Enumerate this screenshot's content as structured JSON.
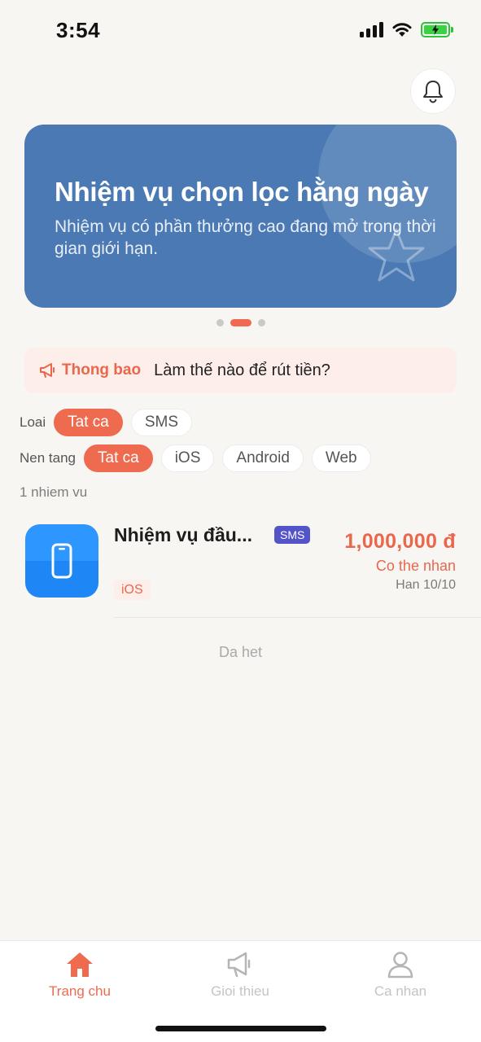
{
  "status_bar": {
    "time": "3:54",
    "icons": [
      "signal-icon",
      "wifi-icon",
      "battery-charging-icon"
    ]
  },
  "header": {
    "bell_icon": "bell-icon"
  },
  "banner": {
    "title": "Nhiệm vụ chọn lọc hằng ngày",
    "subtitle": "Nhiệm vụ có phần thưởng cao đang mở trong thời gian giới hạn.",
    "background_color": "#4a79b4",
    "decoration_icon": "star-icon",
    "pagination": {
      "total": 3,
      "active_index": 1
    }
  },
  "notice": {
    "icon": "megaphone-icon",
    "label": "Thong bao",
    "text": "Làm thế nào để rút tiền?"
  },
  "filters": {
    "type": {
      "label": "Loai",
      "options": [
        "Tat ca",
        "SMS"
      ],
      "selected": "Tat ca"
    },
    "platform": {
      "label": "Nen tang",
      "options": [
        "Tat ca",
        "iOS",
        "Android",
        "Web"
      ],
      "selected": "Tat ca"
    }
  },
  "task_count": "1 nhiem vu",
  "tasks": [
    {
      "icon": "phone-icon",
      "title": "Nhiệm vụ đầu...",
      "badge": "SMS",
      "platform": "iOS",
      "reward": "1,000,000 đ",
      "status": "Co the nhan",
      "deadline": "Han 10/10"
    }
  ],
  "end_text": "Da het",
  "tab_bar": {
    "items": [
      {
        "label": "Trang chu",
        "icon": "home-icon",
        "active": true
      },
      {
        "label": "Gioi thieu",
        "icon": "megaphone-icon",
        "active": false
      },
      {
        "label": "Ca nhan",
        "icon": "user-icon",
        "active": false
      }
    ]
  },
  "colors": {
    "accent": "#ee6b50",
    "banner": "#4a79b4",
    "sms_badge": "#5254c7",
    "background": "#f7f6f2"
  }
}
